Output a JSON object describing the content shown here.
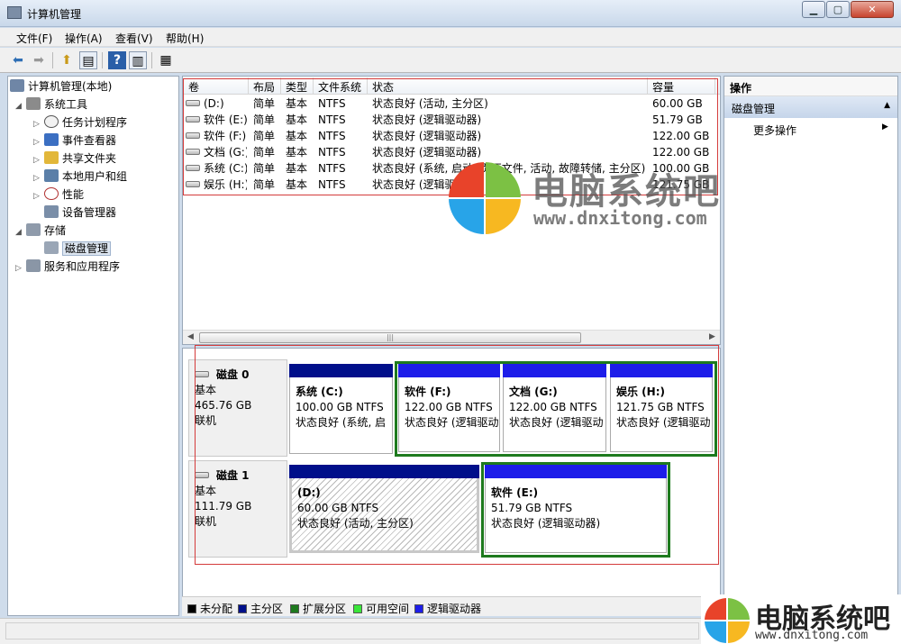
{
  "window": {
    "title": "计算机管理"
  },
  "menu": [
    "文件(F)",
    "操作(A)",
    "查看(V)",
    "帮助(H)"
  ],
  "tree": [
    {
      "label": "计算机管理(本地)",
      "icon": "computer-icon",
      "exp": ""
    },
    {
      "label": "系统工具",
      "icon": "tools-icon",
      "exp": "◢"
    },
    {
      "label": "任务计划程序",
      "icon": "clock-icon",
      "exp": "▷"
    },
    {
      "label": "事件查看器",
      "icon": "event-viewer-icon",
      "exp": "▷"
    },
    {
      "label": "共享文件夹",
      "icon": "shared-folder-icon",
      "exp": "▷"
    },
    {
      "label": "本地用户和组",
      "icon": "users-icon",
      "exp": "▷"
    },
    {
      "label": "性能",
      "icon": "performance-icon",
      "exp": "▷"
    },
    {
      "label": "设备管理器",
      "icon": "device-manager-icon",
      "exp": ""
    },
    {
      "label": "存储",
      "icon": "storage-icon",
      "exp": "◢"
    },
    {
      "label": "磁盘管理",
      "icon": "disk-management-icon",
      "exp": ""
    },
    {
      "label": "服务和应用程序",
      "icon": "services-icon",
      "exp": "▷"
    }
  ],
  "volumes": {
    "headers": [
      "卷",
      "布局",
      "类型",
      "文件系统",
      "状态",
      "容量"
    ],
    "rows": [
      [
        "(D:)",
        "简单",
        "基本",
        "NTFS",
        "状态良好 (活动, 主分区)",
        "60.00 GB"
      ],
      [
        "软件 (E:)",
        "简单",
        "基本",
        "NTFS",
        "状态良好 (逻辑驱动器)",
        "51.79 GB"
      ],
      [
        "软件 (F:)",
        "简单",
        "基本",
        "NTFS",
        "状态良好 (逻辑驱动器)",
        "122.00 GB"
      ],
      [
        "文档 (G:)",
        "简单",
        "基本",
        "NTFS",
        "状态良好 (逻辑驱动器)",
        "122.00 GB"
      ],
      [
        "系统 (C:)",
        "简单",
        "基本",
        "NTFS",
        "状态良好 (系统, 启动, 页面文件, 活动, 故障转储, 主分区)",
        "100.00 GB"
      ],
      [
        "娱乐 (H:)",
        "简单",
        "基本",
        "NTFS",
        "状态良好 (逻辑驱动器)",
        "121.75 GB"
      ]
    ]
  },
  "disks": [
    {
      "name": "磁盘 0",
      "type": "基本",
      "size": "465.76 GB",
      "status": "联机",
      "partitions": [
        {
          "name": "系统 (C:)",
          "size": "100.00 GB NTFS",
          "status": "状态良好 (系统, 启"
        },
        {
          "name": "软件 (F:)",
          "size": "122.00 GB NTFS",
          "status": "状态良好 (逻辑驱动"
        },
        {
          "name": "文档 (G:)",
          "size": "122.00 GB NTFS",
          "status": "状态良好 (逻辑驱动"
        },
        {
          "name": "娱乐 (H:)",
          "size": "121.75 GB NTFS",
          "status": "状态良好 (逻辑驱动"
        }
      ]
    },
    {
      "name": "磁盘 1",
      "type": "基本",
      "size": "111.79 GB",
      "status": "联机",
      "partitions": [
        {
          "name": "(D:)",
          "size": "60.00 GB NTFS",
          "status": "状态良好 (活动, 主分区)"
        },
        {
          "name": "软件 (E:)",
          "size": "51.79 GB NTFS",
          "status": "状态良好 (逻辑驱动器)"
        }
      ]
    }
  ],
  "legend": [
    {
      "label": "未分配",
      "color": "#000000"
    },
    {
      "label": "主分区",
      "color": "#000f8a"
    },
    {
      "label": "扩展分区",
      "color": "#1e7a1e"
    },
    {
      "label": "可用空间",
      "color": "#3ae63a"
    },
    {
      "label": "逻辑驱动器",
      "color": "#1d1de9"
    }
  ],
  "actions": {
    "header": "操作",
    "section": "磁盘管理",
    "more": "更多操作"
  },
  "watermark": {
    "title": "电脑系统吧",
    "url": "www.dnxitong.com"
  }
}
